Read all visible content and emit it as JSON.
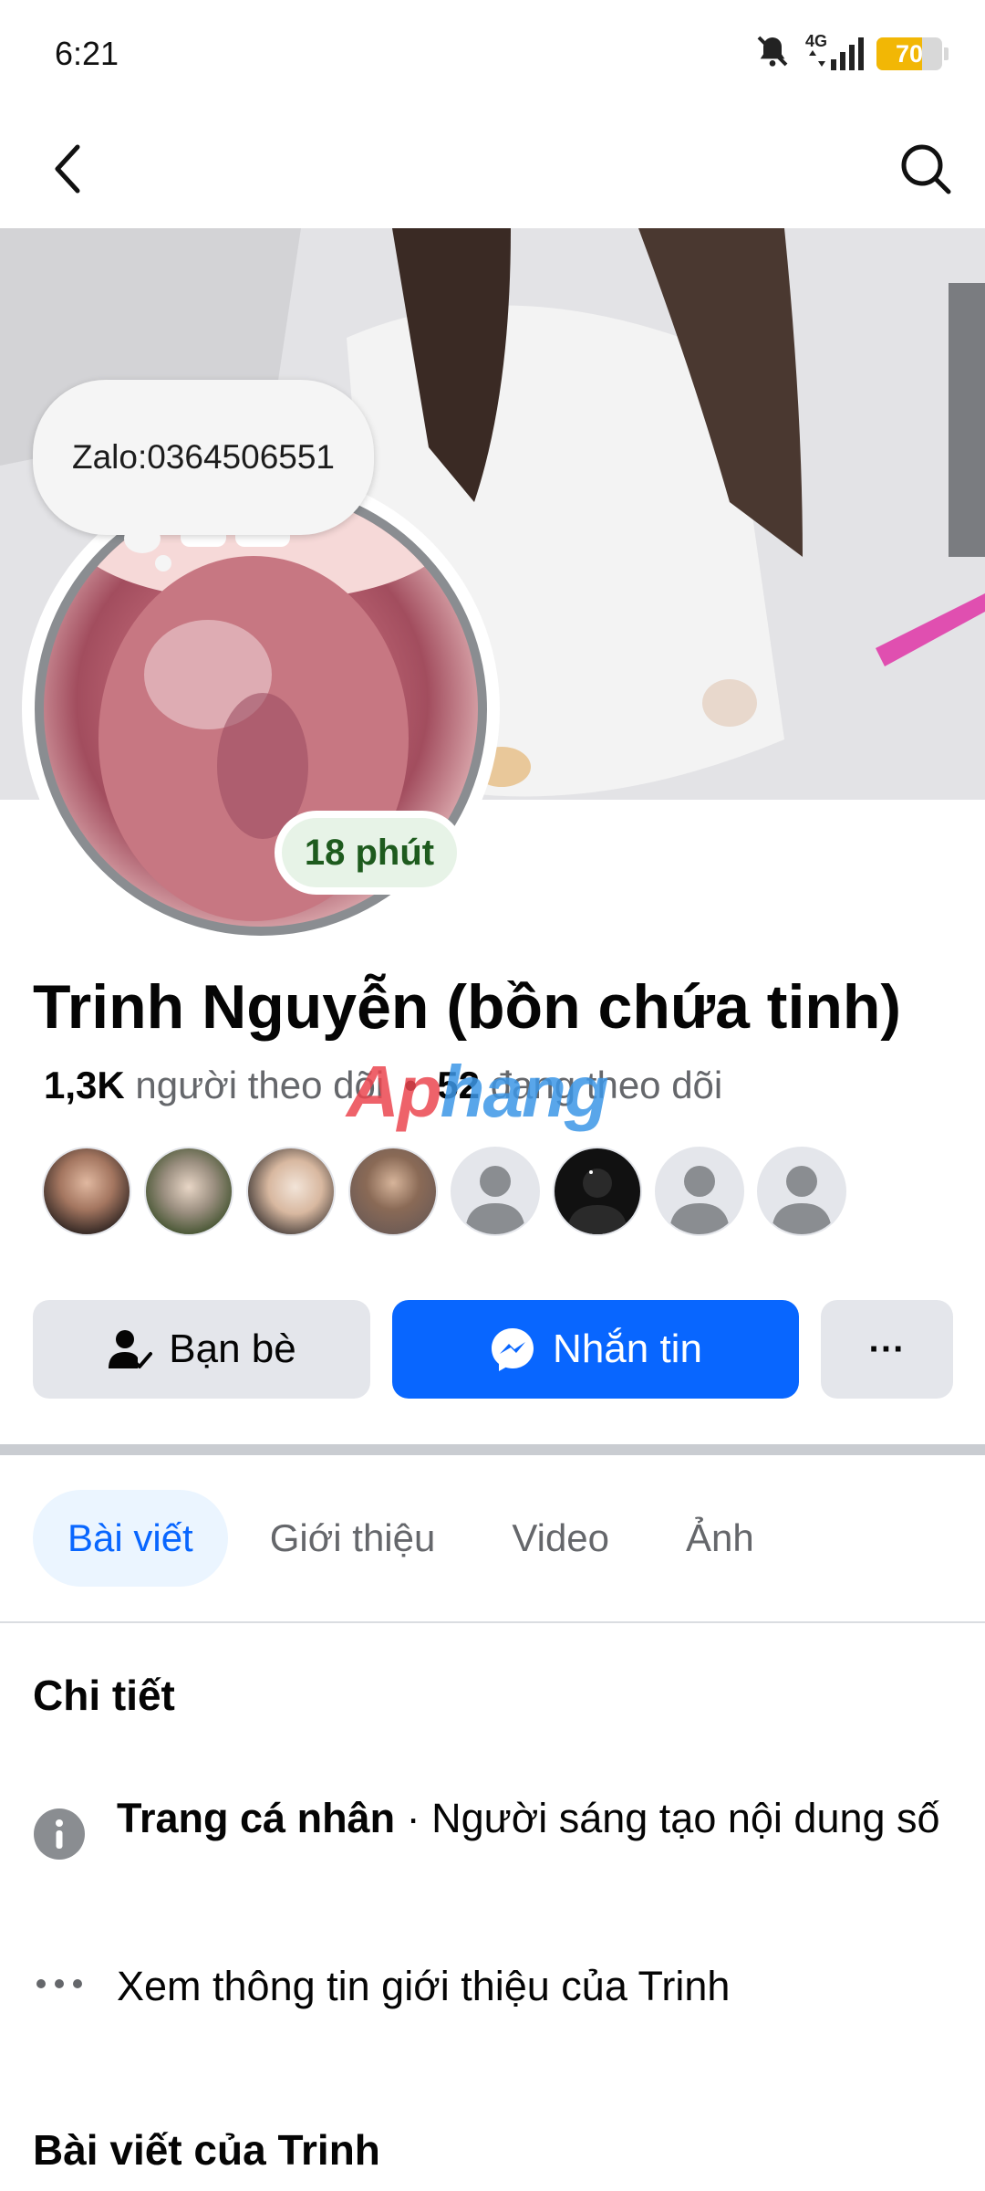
{
  "status_bar": {
    "time": "6:21",
    "network_label": "4G",
    "battery_level": "70",
    "battery_color": "#f2b705"
  },
  "nav": {
    "back_icon": "back-arrow-icon",
    "search_icon": "search-icon"
  },
  "profile": {
    "note": "Zalo:0364506551",
    "active_status": "18 phút",
    "name": "Trinh Nguyễn (bồn chứa tinh)",
    "followers_count": "1,3K",
    "followers_label": "người theo dõi",
    "separator": "•",
    "following_count": "52",
    "following_label": "đang theo dõi",
    "watermark": {
      "part1": "Ap",
      "part2": "hang"
    },
    "mutual_friend_avatars": 8
  },
  "actions": {
    "friends_label": "Bạn bè",
    "message_label": "Nhắn tin",
    "more_label": "···",
    "accent_color": "#0866ff"
  },
  "tabs": [
    {
      "label": "Bài viết",
      "active": true
    },
    {
      "label": "Giới thiệu",
      "active": false
    },
    {
      "label": "Video",
      "active": false
    },
    {
      "label": "Ảnh",
      "active": false
    }
  ],
  "details": {
    "title": "Chi tiết",
    "page_type_bold": "Trang cá nhân",
    "page_type_rest": " · Người sáng tạo nội dung số",
    "see_about": "Xem thông tin giới thiệu của Trinh"
  },
  "posts": {
    "title": "Bài viết của Trinh"
  }
}
